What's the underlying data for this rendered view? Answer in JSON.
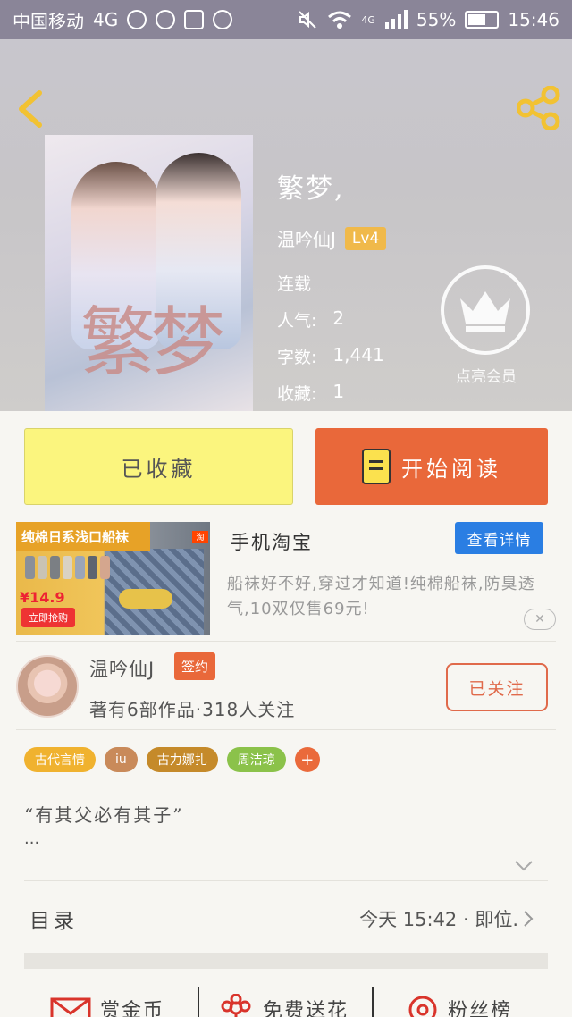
{
  "status_bar": {
    "carrier": "中国移动",
    "network": "4G",
    "signal_label": "4G",
    "battery": "55%",
    "time": "15:46"
  },
  "book": {
    "title": "繁梦,",
    "author": "温吟仙J",
    "level": "Lv4",
    "status": "连载",
    "popularity_label": "人气:",
    "popularity": "2",
    "words_label": "字数:",
    "words": "1,441",
    "favorites_label": "收藏:",
    "favorites": "1",
    "cover_title": "繁梦"
  },
  "vip": {
    "label": "点亮会员"
  },
  "actions": {
    "collect_label": "已收藏",
    "read_label": "开始阅读"
  },
  "ad": {
    "title": "手机淘宝",
    "detail_label": "查看详情",
    "description": "船袜好不好,穿过才知道!纯棉船袜,防臭透气,10双仅售69元!",
    "banner_text": "纯棉日系浅口船袜",
    "price": "¥14.9",
    "buy_label": "立即抢购",
    "close_label": "✕",
    "colors": {
      "banner": "#e7a227",
      "button": "#2a7ee3"
    }
  },
  "author": {
    "name": "温吟仙J",
    "badge": "签约",
    "stats": "著有6部作品·318人关注",
    "follow_label": "已关注"
  },
  "tags": [
    {
      "label": "古代言情",
      "color": "#f0b22f"
    },
    {
      "label": "iu",
      "color": "#c98a5a"
    },
    {
      "label": "古力娜扎",
      "color": "#c58a2a"
    },
    {
      "label": "周洁琼",
      "color": "#8bc24a"
    }
  ],
  "tag_add_label": "+",
  "intro": {
    "quote": "“有其父必有其子”",
    "ellipsis": "..."
  },
  "toc": {
    "label": "目录",
    "update": "今天 15:42 · 即位."
  },
  "bottom_bar": [
    {
      "label": "赏金币",
      "icon": "envelope-icon"
    },
    {
      "label": "免费送花",
      "icon": "flower-icon"
    },
    {
      "label": "粉丝榜",
      "icon": "ranking-icon"
    }
  ]
}
